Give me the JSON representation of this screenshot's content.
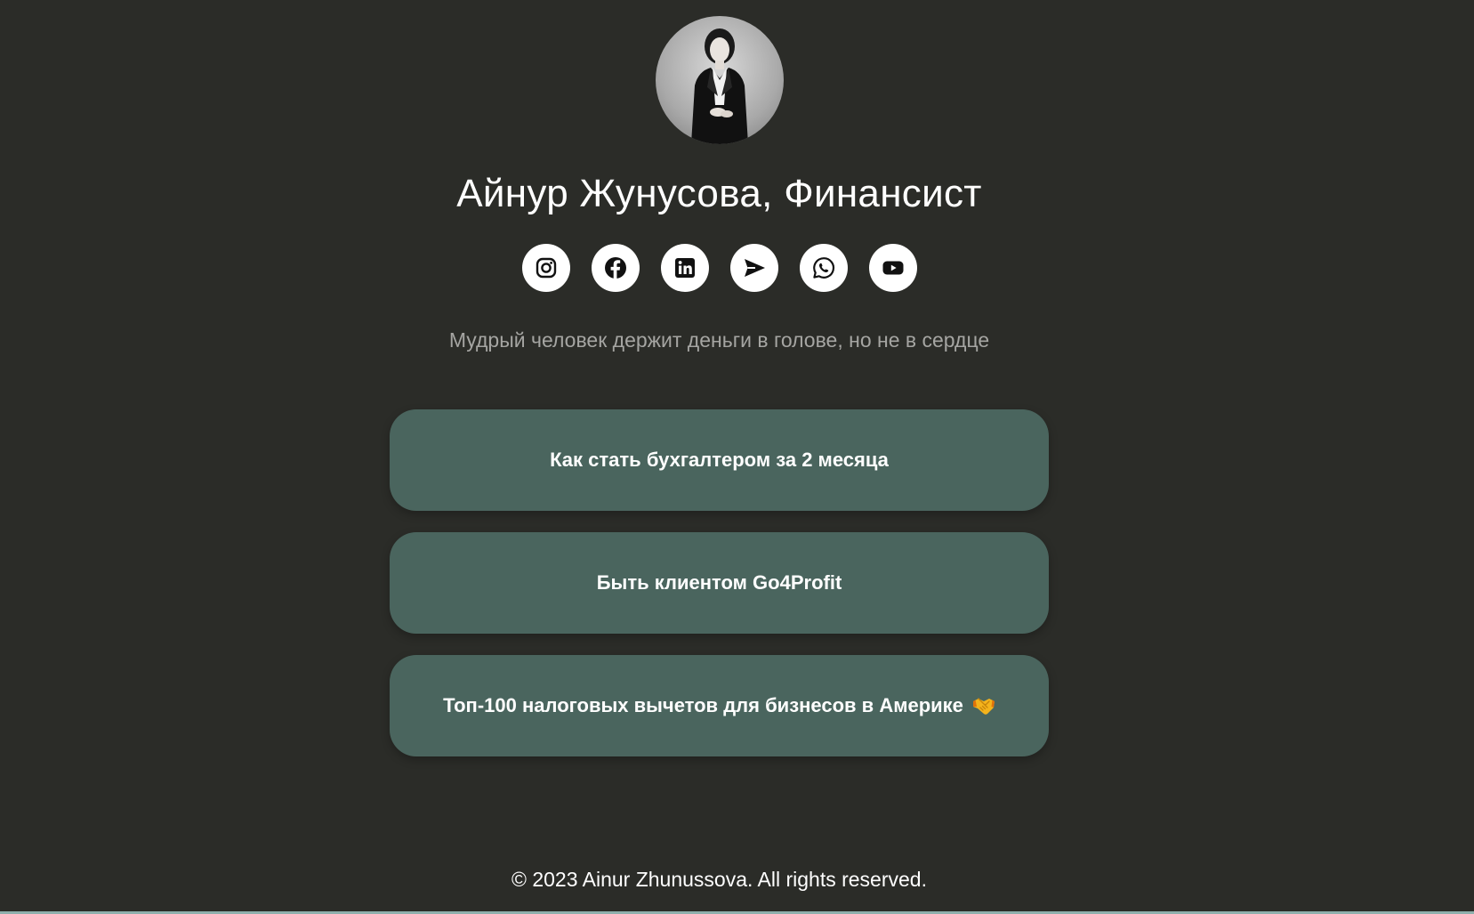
{
  "profile": {
    "name": "Айнур Жунусова, Финансист",
    "tagline": "Мудрый человек держит деньги в голове, но не в сердце"
  },
  "socials": [
    {
      "icon": "instagram-icon"
    },
    {
      "icon": "facebook-icon"
    },
    {
      "icon": "linkedin-icon"
    },
    {
      "icon": "telegram-icon"
    },
    {
      "icon": "whatsapp-icon"
    },
    {
      "icon": "youtube-icon"
    }
  ],
  "links": [
    {
      "label": "Как стать бухгалтером за 2 месяца"
    },
    {
      "label": "Быть клиентом Go4Profit"
    },
    {
      "label": "Топ-100 налоговых вычетов для бизнесов в Америке",
      "emoji": "handshake-icon"
    }
  ],
  "footer": {
    "copyright": "© 2023 Ainur Zhunussova. All rights reserved."
  },
  "colors": {
    "background": "#2b2c28",
    "button": "#4a655e",
    "tagline": "#a5a5a2"
  }
}
